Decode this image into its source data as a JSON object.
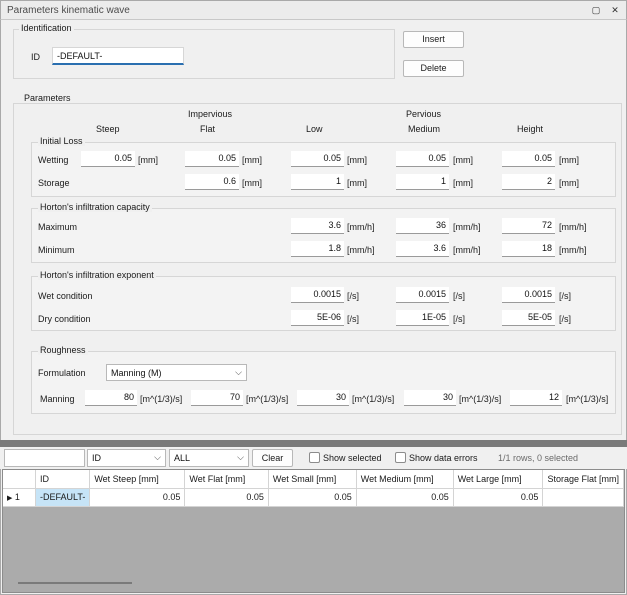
{
  "window": {
    "title": "Parameters kinematic wave",
    "restore_glyph": "▢",
    "close_glyph": "✕"
  },
  "identification": {
    "group_label": "Identification",
    "id_label": "ID",
    "id_value": "-DEFAULT-",
    "insert_label": "Insert",
    "delete_label": "Delete"
  },
  "parameters": {
    "group_label": "Parameters",
    "col_group_impervious": "Impervious",
    "col_group_pervious": "Pervious",
    "columns": [
      "Steep",
      "Flat",
      "Low",
      "Medium",
      "Height"
    ],
    "initial_loss": {
      "label": "Initial Loss",
      "wetting": {
        "label": "Wetting",
        "values": [
          "0.05",
          "0.05",
          "0.05",
          "0.05",
          "0.05"
        ],
        "unit": "[mm]"
      },
      "storage": {
        "label": "Storage",
        "values": [
          "0.6",
          "1",
          "1",
          "2"
        ],
        "unit": "[mm]"
      }
    },
    "horton_capacity": {
      "label": "Horton's infiltration capacity",
      "maximum": {
        "label": "Maximum",
        "values": [
          "3.6",
          "36",
          "72"
        ],
        "unit": "[mm/h]"
      },
      "minimum": {
        "label": "Minimum",
        "values": [
          "1.8",
          "3.6",
          "18"
        ],
        "unit": "[mm/h]"
      }
    },
    "horton_exponent": {
      "label": "Horton's infiltration exponent",
      "wet": {
        "label": "Wet condition",
        "values": [
          "0.0015",
          "0.0015",
          "0.0015"
        ],
        "unit": "[/s]"
      },
      "dry": {
        "label": "Dry condition",
        "values": [
          "5E-06",
          "1E-05",
          "5E-05"
        ],
        "unit": "[/s]"
      }
    },
    "roughness": {
      "label": "Roughness",
      "formulation_label": "Formulation",
      "formulation_value": "Manning (M)",
      "manning_label": "Manning",
      "manning_values": [
        "80",
        "70",
        "30",
        "30",
        "12"
      ],
      "manning_unit": "[m^(1/3)/s]"
    }
  },
  "toolbar": {
    "filter_value": "",
    "column_select": "ID",
    "scope_select": "ALL",
    "clear_label": "Clear",
    "show_selected_label": "Show selected",
    "show_errors_label": "Show data errors",
    "status": "1/1 rows, 0 selected"
  },
  "grid": {
    "columns": [
      "ID",
      "Wet Steep [mm]",
      "Wet Flat [mm]",
      "Wet Small [mm]",
      "Wet Medium [mm]",
      "Wet Large [mm]",
      "Storage Flat [mm]"
    ],
    "rows": [
      {
        "row_num": "1",
        "cells": [
          "-DEFAULT-",
          "0.05",
          "0.05",
          "0.05",
          "0.05",
          "0.05",
          ""
        ]
      }
    ]
  },
  "colors": {
    "accent": "#2a6fb0",
    "selected_cell": "#c6e4f7",
    "splitter": "#7a7a7a"
  },
  "icons": {
    "row_pointer": "▶",
    "chevron_down": "⌵"
  }
}
